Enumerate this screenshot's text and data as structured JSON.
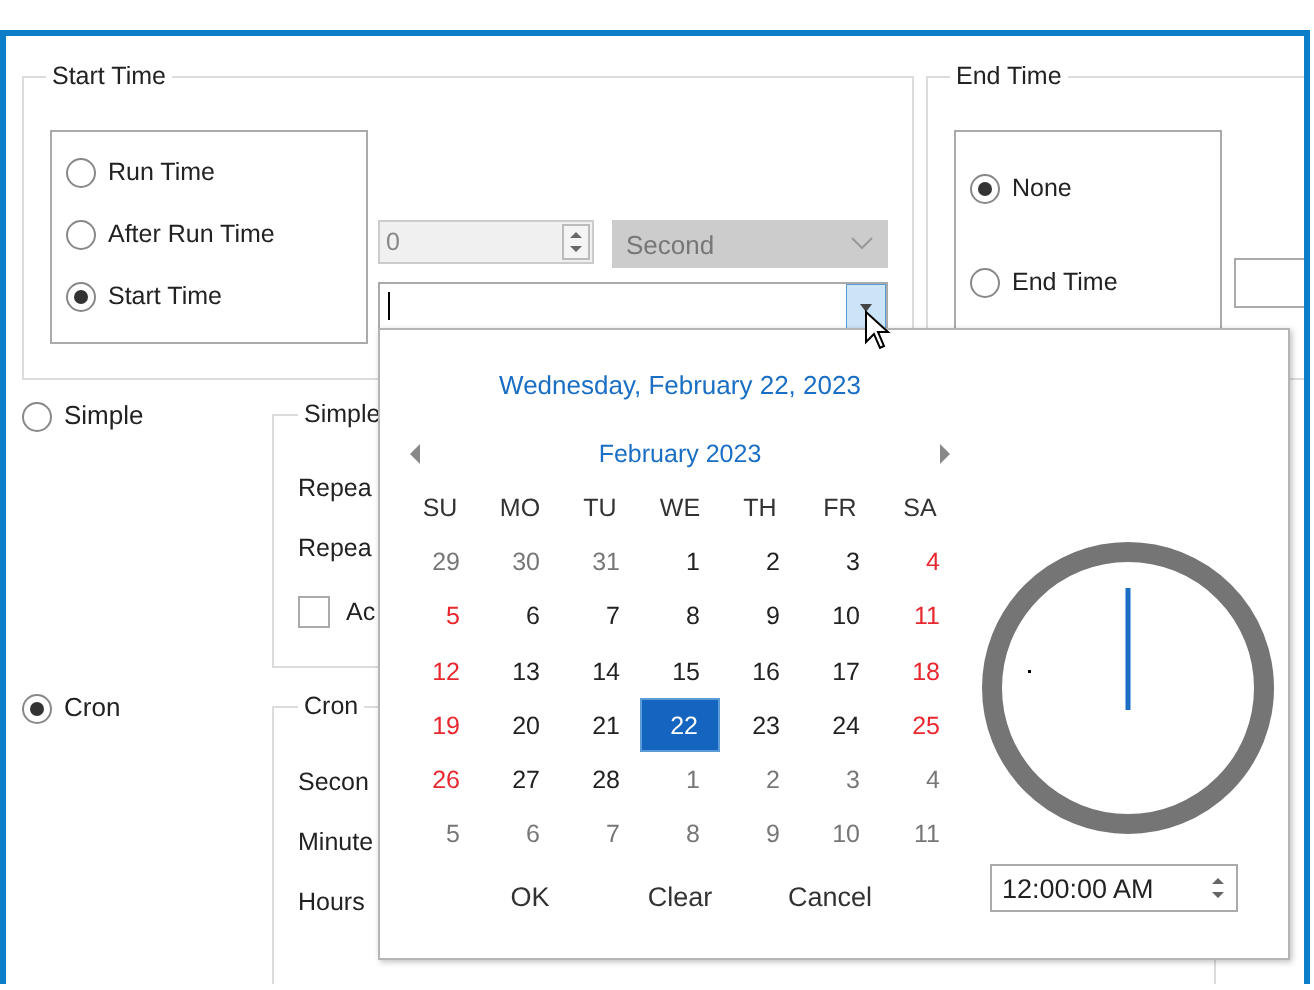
{
  "start_time": {
    "title": "Start Time",
    "options": [
      {
        "label": "Run Time",
        "selected": false
      },
      {
        "label": "After Run Time",
        "selected": false
      },
      {
        "label": "Start Time",
        "selected": true
      }
    ],
    "amount": {
      "value": "0",
      "disabled": true
    },
    "unit": {
      "value": "Second",
      "disabled": true
    }
  },
  "end_time": {
    "title": "End Time",
    "options": [
      {
        "label": "None",
        "selected": true
      },
      {
        "label": "End Time",
        "selected": false
      }
    ]
  },
  "schedule_types": [
    {
      "label": "Simple",
      "selected": false
    },
    {
      "label": "Cron",
      "selected": true
    }
  ],
  "simple_group": {
    "title": "Simple",
    "labels": [
      "Repea",
      "Repea"
    ],
    "checkbox": {
      "label": "Ac",
      "checked": false
    }
  },
  "cron_group": {
    "title": "Cron",
    "labels": [
      "Secon",
      "Minute",
      "Hours"
    ]
  },
  "calendar_popup": {
    "header": "Wednesday, February 22, 2023",
    "month": "February 2023",
    "weekdays": [
      "SU",
      "MO",
      "TU",
      "WE",
      "TH",
      "FR",
      "SA"
    ],
    "weeks": [
      [
        {
          "day": "29",
          "kind": "adjacent",
          "selected": false
        },
        {
          "day": "30",
          "kind": "adjacent",
          "selected": false
        },
        {
          "day": "31",
          "kind": "adjacent",
          "selected": false
        },
        {
          "day": "1",
          "kind": "weekday",
          "selected": false
        },
        {
          "day": "2",
          "kind": "weekday",
          "selected": false
        },
        {
          "day": "3",
          "kind": "weekday",
          "selected": false
        },
        {
          "day": "4",
          "kind": "weekend",
          "selected": false
        }
      ],
      [
        {
          "day": "5",
          "kind": "weekend",
          "selected": false
        },
        {
          "day": "6",
          "kind": "weekday",
          "selected": false
        },
        {
          "day": "7",
          "kind": "weekday",
          "selected": false
        },
        {
          "day": "8",
          "kind": "weekday",
          "selected": false
        },
        {
          "day": "9",
          "kind": "weekday",
          "selected": false
        },
        {
          "day": "10",
          "kind": "weekday",
          "selected": false
        },
        {
          "day": "11",
          "kind": "weekend",
          "selected": false
        }
      ],
      [
        {
          "day": "12",
          "kind": "weekend",
          "selected": false
        },
        {
          "day": "13",
          "kind": "weekday",
          "selected": false
        },
        {
          "day": "14",
          "kind": "weekday",
          "selected": false
        },
        {
          "day": "15",
          "kind": "weekday",
          "selected": false
        },
        {
          "day": "16",
          "kind": "weekday",
          "selected": false
        },
        {
          "day": "17",
          "kind": "weekday",
          "selected": false
        },
        {
          "day": "18",
          "kind": "weekend",
          "selected": false
        }
      ],
      [
        {
          "day": "19",
          "kind": "weekend",
          "selected": false
        },
        {
          "day": "20",
          "kind": "weekday",
          "selected": false
        },
        {
          "day": "21",
          "kind": "weekday",
          "selected": false
        },
        {
          "day": "22",
          "kind": "weekday",
          "selected": true
        },
        {
          "day": "23",
          "kind": "weekday",
          "selected": false
        },
        {
          "day": "24",
          "kind": "weekday",
          "selected": false
        },
        {
          "day": "25",
          "kind": "weekend",
          "selected": false
        }
      ],
      [
        {
          "day": "26",
          "kind": "weekend",
          "selected": false
        },
        {
          "day": "27",
          "kind": "weekday",
          "selected": false
        },
        {
          "day": "28",
          "kind": "weekday",
          "selected": false
        },
        {
          "day": "1",
          "kind": "adjacent",
          "selected": false
        },
        {
          "day": "2",
          "kind": "adjacent",
          "selected": false
        },
        {
          "day": "3",
          "kind": "adjacent",
          "selected": false
        },
        {
          "day": "4",
          "kind": "adjacent",
          "selected": false
        }
      ],
      [
        {
          "day": "5",
          "kind": "adjacent",
          "selected": false
        },
        {
          "day": "6",
          "kind": "adjacent",
          "selected": false
        },
        {
          "day": "7",
          "kind": "adjacent",
          "selected": false
        },
        {
          "day": "8",
          "kind": "adjacent",
          "selected": false
        },
        {
          "day": "9",
          "kind": "adjacent",
          "selected": false
        },
        {
          "day": "10",
          "kind": "adjacent",
          "selected": false
        },
        {
          "day": "11",
          "kind": "adjacent",
          "selected": false
        }
      ]
    ],
    "buttons": [
      "OK",
      "Clear",
      "Cancel"
    ],
    "time": "12:00:00 AM"
  }
}
